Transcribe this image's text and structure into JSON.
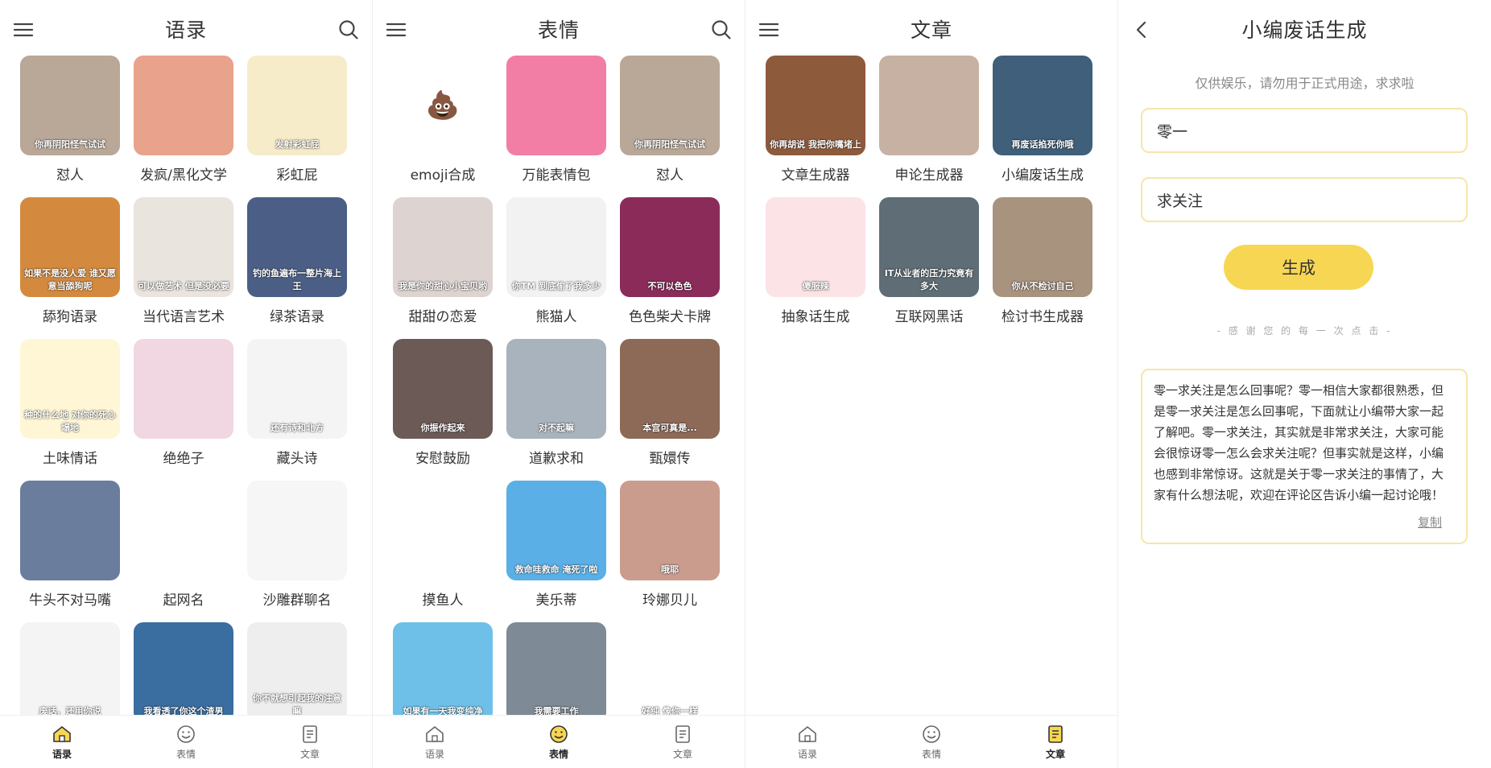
{
  "panels": [
    {
      "title": "语录",
      "items": [
        {
          "label": "怼人",
          "caption": "你再阴阳怪气试试",
          "bg": "#b9a797"
        },
        {
          "label": "发疯/黑化文学",
          "caption": "",
          "bg": "#e9a28c"
        },
        {
          "label": "彩虹屁",
          "caption": "发射彩虹屁",
          "bg": "#f6ecc9"
        },
        {
          "label": "舔狗语录",
          "caption": "如果不是没人爱 谁又愿意当舔狗呢",
          "bg": "#d48a3e"
        },
        {
          "label": "当代语言艺术",
          "caption": "可以做艺术 但是没必要",
          "bg": "#e9e4de"
        },
        {
          "label": "绿茶语录",
          "caption": "钓的鱼遍布一整片海上王",
          "bg": "#4b5f86"
        },
        {
          "label": "土味情话",
          "caption": "种的什么地 对你的死心塌地",
          "bg": "#fff6d6"
        },
        {
          "label": "绝绝子",
          "caption": "",
          "bg": "#f0d7e2"
        },
        {
          "label": "藏头诗",
          "caption": "还有诗和北方",
          "bg": "#f4f4f4"
        },
        {
          "label": "牛头不对马嘴",
          "caption": "",
          "bg": "#6a7d9d"
        },
        {
          "label": "起网名",
          "caption": "",
          "bg": "#ffffff"
        },
        {
          "label": "沙雕群聊名",
          "caption": "",
          "bg": "#f6f6f6"
        },
        {
          "label": "",
          "caption": "废话，还用你说",
          "bg": "#f4f4f4"
        },
        {
          "label": "",
          "caption": "我看透了你这个渣男",
          "bg": "#3a6da0"
        },
        {
          "label": "",
          "caption": "你不就想引起我的注意嘛",
          "bg": "#eeeeee"
        }
      ]
    },
    {
      "title": "表情",
      "items": [
        {
          "label": "emoji合成",
          "caption": "💩",
          "bg": "#ffffff"
        },
        {
          "label": "万能表情包",
          "caption": "",
          "bg": "#f27ea6"
        },
        {
          "label": "怼人",
          "caption": "你再阴阳怪气试试",
          "bg": "#b9a797"
        },
        {
          "label": "甜甜の恋爱",
          "caption": "我是你的甜心小宝贝哟",
          "bg": "#ddd3d0"
        },
        {
          "label": "熊猫人",
          "caption": "你TM 到底偷了我多少",
          "bg": "#f2f2f2"
        },
        {
          "label": "色色柴犬卡牌",
          "caption": "不可以色色",
          "bg": "#8a2b5a"
        },
        {
          "label": "安慰鼓励",
          "caption": "你振作起来",
          "bg": "#6b5a56"
        },
        {
          "label": "道歉求和",
          "caption": "对不起嘛",
          "bg": "#a9b3bd"
        },
        {
          "label": "甄嬛传",
          "caption": "本宫可真是...",
          "bg": "#8d6a57"
        },
        {
          "label": "摸鱼人",
          "caption": "",
          "bg": "#ffffff"
        },
        {
          "label": "美乐蒂",
          "caption": "救命哇救命 淹死了啦",
          "bg": "#5ab0e6"
        },
        {
          "label": "玲娜贝儿",
          "caption": "哦耶",
          "bg": "#c99c8e"
        },
        {
          "label": "",
          "caption": "如果有一天我变纯净",
          "bg": "#6ec0e8"
        },
        {
          "label": "",
          "caption": "我需要工作",
          "bg": "#7e8a95"
        },
        {
          "label": "",
          "caption": "好纯 像你一样",
          "bg": "#ffffff"
        }
      ]
    },
    {
      "title": "文章",
      "items": [
        {
          "label": "文章生成器",
          "caption": "你再胡说 我把你嘴堵上",
          "bg": "#8e5a3c"
        },
        {
          "label": "申论生成器",
          "caption": "",
          "bg": "#c7b1a3"
        },
        {
          "label": "小编废话生成",
          "caption": "再废话掐死你哦",
          "bg": "#3f5f7a"
        },
        {
          "label": "抽象话生成",
          "caption": "傻服辣",
          "bg": "#fbe3e6"
        },
        {
          "label": "互联网黑话",
          "caption": "IT从业者的压力究竟有多大",
          "bg": "#5f6d76"
        },
        {
          "label": "检讨书生成器",
          "caption": "你从不检讨自己",
          "bg": "#a8937f"
        }
      ]
    }
  ],
  "tabs": [
    {
      "label": "语录",
      "icon": "home-icon"
    },
    {
      "label": "表情",
      "icon": "smiley-icon"
    },
    {
      "label": "文章",
      "icon": "document-icon"
    }
  ],
  "generator": {
    "title": "小编废话生成",
    "notice": "仅供娱乐，请勿用于正式用途，求求啦",
    "input1": "零一",
    "input2": "求关注",
    "button": "生成",
    "thanks": "- 感 谢 您 的 每 一 次 点 击 -",
    "result": "零一求关注是怎么回事呢？零一相信大家都很熟悉，但是零一求关注是怎么回事呢，下面就让小编带大家一起了解吧。零一求关注，其实就是非常求关注，大家可能会很惊讶零一怎么会求关注呢？但事实就是这样，小编也感到非常惊讶。这就是关于零一求关注的事情了，大家有什么想法呢，欢迎在评论区告诉小编一起讨论哦！",
    "copy": "复制"
  },
  "colors": {
    "accent": "#f7d653",
    "border": "#f6e6a8"
  }
}
